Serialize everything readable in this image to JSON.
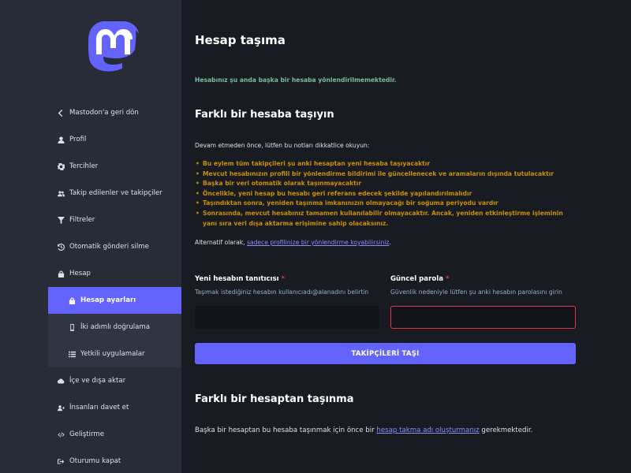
{
  "colors": {
    "accent": "#6364ff",
    "sidebar_bg": "#282c37",
    "main_bg": "#191b22",
    "success": "#79bd9a",
    "warning": "#ca8f04",
    "error": "#e0364a"
  },
  "sidebar": {
    "items": [
      {
        "label": "Mastodon'a geri dön",
        "icon": "chevron-left-icon"
      },
      {
        "label": "Profil",
        "icon": "user-icon"
      },
      {
        "label": "Tercihler",
        "icon": "gear-icon"
      },
      {
        "label": "Takip edilenler ve takipçiler",
        "icon": "users-icon"
      },
      {
        "label": "Filtreler",
        "icon": "filter-icon"
      },
      {
        "label": "Otomatik gönderi silme",
        "icon": "history-icon"
      },
      {
        "label": "Hesap",
        "icon": "lock-icon"
      },
      {
        "label": "Hesap ayarları",
        "icon": "lock-icon"
      },
      {
        "label": "İki adımlı doğrulama",
        "icon": "mobile-icon"
      },
      {
        "label": "Yetkili uygulamalar",
        "icon": "list-icon"
      },
      {
        "label": "İçe ve dışa aktar",
        "icon": "cloud-icon"
      },
      {
        "label": "İnsanları davet et",
        "icon": "user-plus-icon"
      },
      {
        "label": "Geliştirme",
        "icon": "code-icon"
      },
      {
        "label": "Oturumu kapat",
        "icon": "sign-out-icon"
      }
    ]
  },
  "main": {
    "title": "Hesap taşıma",
    "notice": "Hesabınız şu anda başka bir hesaba yönlendirilmemektedir.",
    "move_to": {
      "heading": "Farklı bir hesaba taşıyın",
      "intro": "Devam etmeden önce, lütfen bu notları dikkatlice okuyun:",
      "bullets": [
        "Bu eylem tüm takipçileri şu anki hesaptan yeni hesaba taşıyacaktır",
        "Mevcut hesabınızın profili bir yönlendirme bildirimi ile güncellenecek ve aramaların dışında tutulacaktır",
        "Başka bir veri otomatik olarak taşınmayacaktır",
        "Öncelikle, yeni hesap bu hesabı geri referans edecek şekilde yapılandırılmalıdır",
        "Taşındıktan sonra, yeniden taşınma imkanınızın olmayacağı bir soğuma periyodu vardır",
        "Sonrasında, mevcut hesabınız tamamen kullanılabilir olmayacaktır. Ancak, yeniden etkinleştirme işleminin yanı sıra veri dışa aktarma erişimine sahip olacaksınız."
      ],
      "alt_prefix": "Alternatif olarak, ",
      "alt_link": "sadece profilinize bir yönlendirme koyabilirsiniz",
      "alt_suffix": ".",
      "new_account_label": "Yeni hesabın tanıtıcısı",
      "new_account_hint": "Taşımak istediğiniz hesabın kullanıcıadı@alanadını belirtin",
      "new_account_value": "",
      "password_label": "Güncel parola",
      "password_hint": "Güvenlik nedeniyle lütfen şu anki hesabın parolasını girin",
      "password_value": "",
      "required_mark": "*",
      "submit_label": "TAKİPÇİLERİ TAŞI"
    },
    "move_from": {
      "heading": "Farklı bir hesaptan taşınma",
      "text_prefix": "Başka bir hesaptan bu hesaba taşınmak için önce bir ",
      "link": "hesap takma adı oluşturmanız",
      "text_suffix": " gerekmektedir."
    }
  }
}
